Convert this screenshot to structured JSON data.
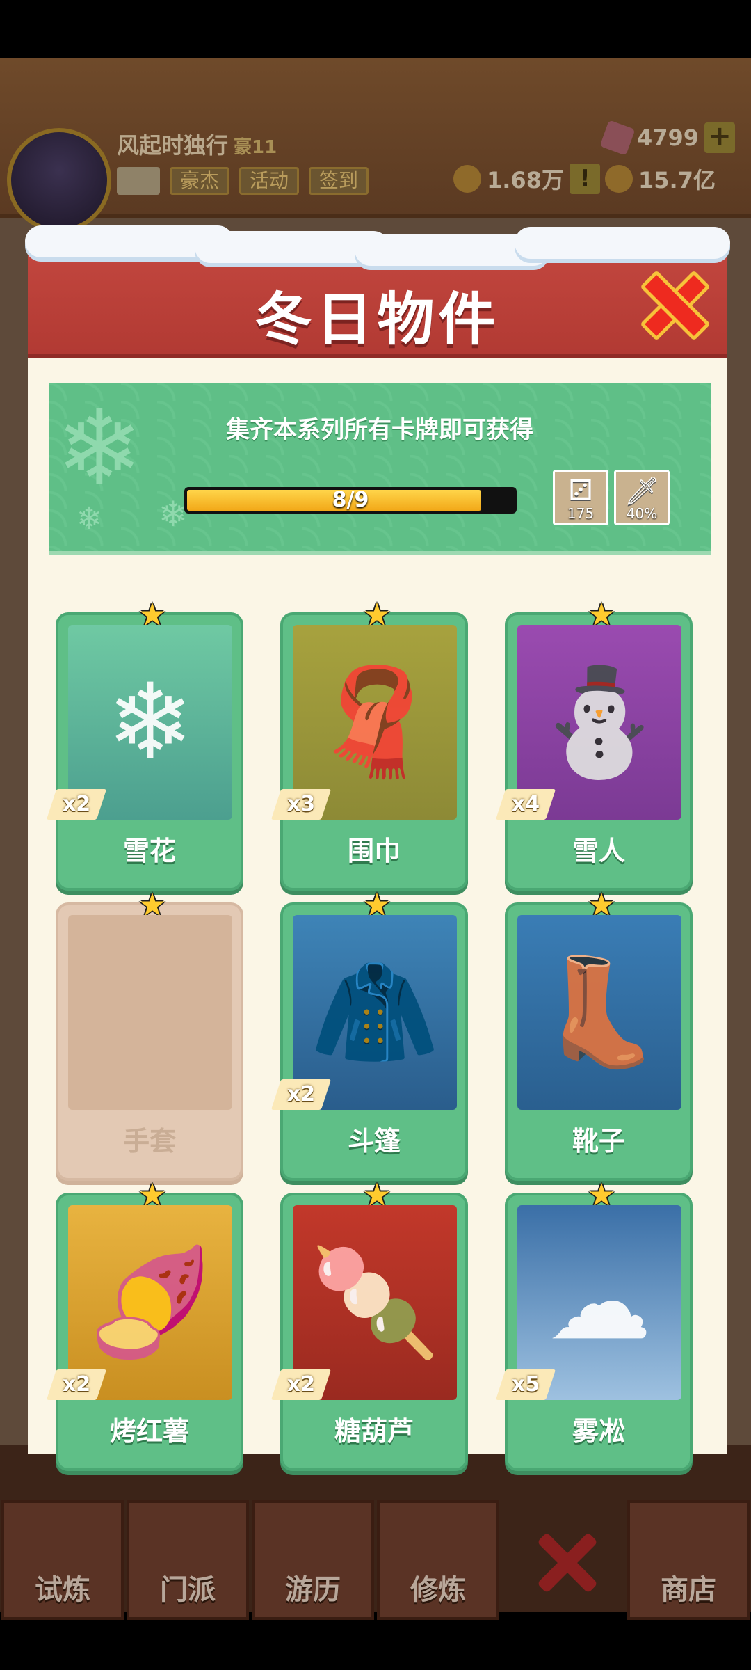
{
  "background": {
    "player_name": "风起时独行",
    "player_rank": "豪11",
    "tags": [
      "豪杰",
      "活动",
      "签到"
    ],
    "gems": "4799",
    "power": "1.68万",
    "coins": "15.7亿",
    "tabs": [
      "试炼",
      "门派",
      "游历",
      "修炼",
      "商店"
    ]
  },
  "modal": {
    "title": "冬日物件",
    "banner_text": "集齐本系列所有卡牌即可获得",
    "progress": {
      "current": 8,
      "total": 9,
      "label": "8/9",
      "fraction": 0.9
    },
    "rewards": [
      {
        "icon": "dice-icon",
        "glyph": "⚂",
        "count": "175"
      },
      {
        "icon": "sword-icon",
        "glyph": "🗡",
        "count": "40%"
      }
    ],
    "cards": [
      {
        "name": "雪花",
        "count": "x2",
        "art": "snowflake",
        "glyph": "❄",
        "locked": false
      },
      {
        "name": "围巾",
        "count": "x3",
        "art": "scarf",
        "glyph": "🧣",
        "locked": false
      },
      {
        "name": "雪人",
        "count": "x4",
        "art": "snowman",
        "glyph": "⛄",
        "locked": false
      },
      {
        "name": "手套",
        "count": "",
        "art": "gloves",
        "glyph": "",
        "locked": true
      },
      {
        "name": "斗篷",
        "count": "x2",
        "art": "cloak",
        "glyph": "🧥",
        "locked": false
      },
      {
        "name": "靴子",
        "count": "",
        "art": "boots",
        "glyph": "👢",
        "locked": false
      },
      {
        "name": "烤红薯",
        "count": "x2",
        "art": "potato",
        "glyph": "🍠",
        "locked": false
      },
      {
        "name": "糖葫芦",
        "count": "x2",
        "art": "candy",
        "glyph": "🍡",
        "locked": false
      },
      {
        "name": "雾凇",
        "count": "x5",
        "art": "rime",
        "glyph": "☁",
        "locked": false
      }
    ]
  },
  "colors": {
    "header_red": "#c3473f",
    "card_green": "#5fbf87",
    "star_gold": "#ffcb2e",
    "close_red": "#ee2a1f"
  }
}
